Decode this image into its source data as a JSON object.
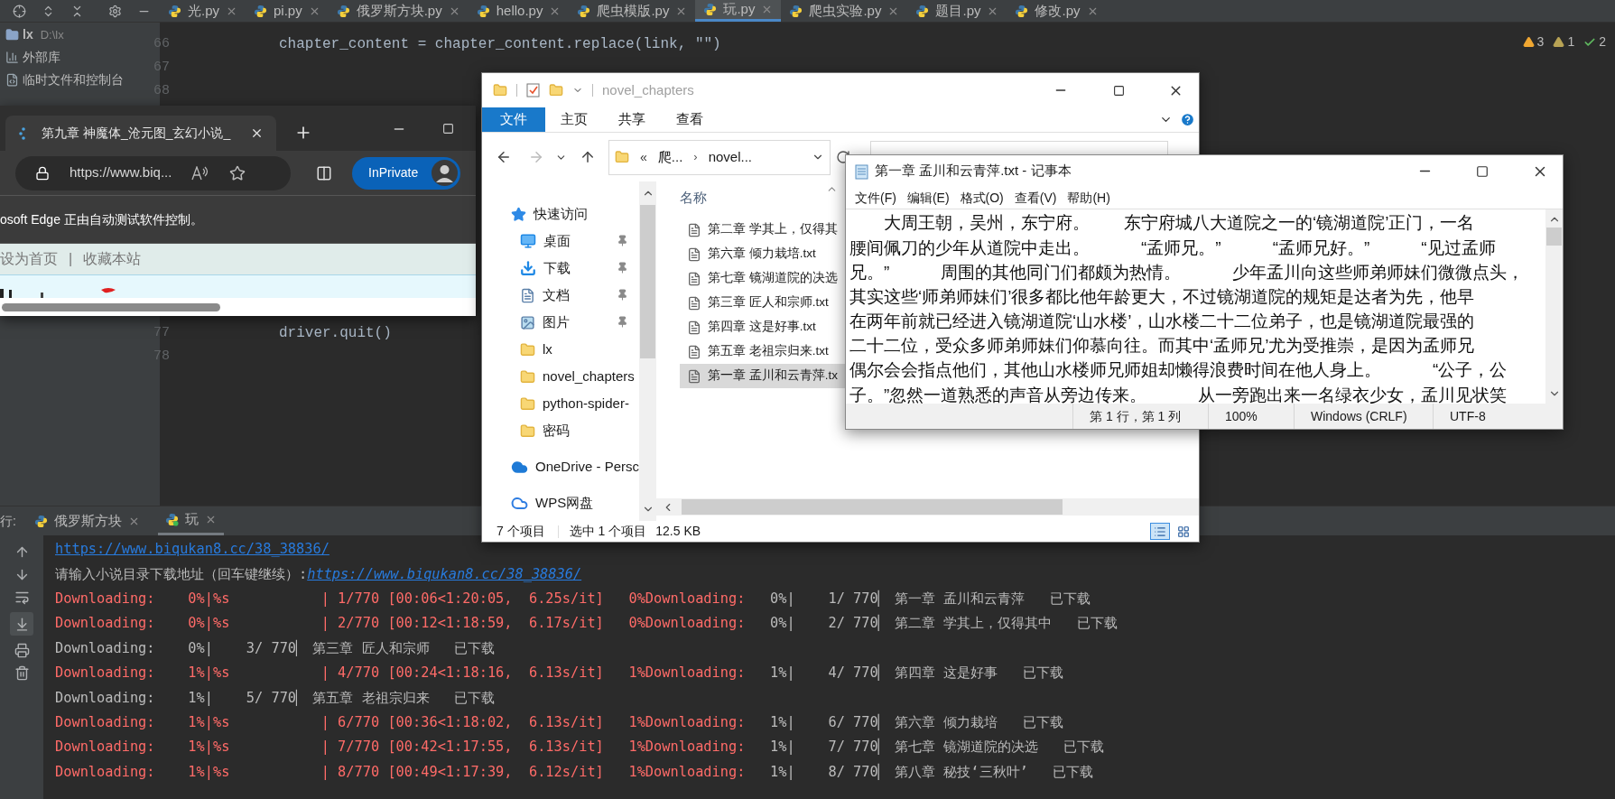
{
  "ide": {
    "tabs": [
      {
        "label": "光.py",
        "selected": false
      },
      {
        "label": "pi.py",
        "selected": false
      },
      {
        "label": "俄罗斯方块.py",
        "selected": false
      },
      {
        "label": "hello.py",
        "selected": false
      },
      {
        "label": "爬虫模版.py",
        "selected": false
      },
      {
        "label": "玩.py",
        "selected": true
      },
      {
        "label": "爬虫实验.py",
        "selected": false
      },
      {
        "label": "题目.py",
        "selected": false
      },
      {
        "label": "修改.py",
        "selected": false
      }
    ],
    "project_tree": [
      {
        "label": "lx",
        "detail": "D:\\lx",
        "kind": "folder"
      },
      {
        "label": "外部库",
        "kind": "library"
      },
      {
        "label": "临时文件和控制台",
        "kind": "scratch"
      }
    ],
    "editor": {
      "top_lines": [
        {
          "number": "66",
          "code": "chapter_content = chapter_content.replace(link, \"\")"
        },
        {
          "number": "67"
        },
        {
          "number": "68"
        }
      ],
      "bottom_lines": [
        {
          "number": "77",
          "code": "driver.quit()"
        },
        {
          "number": "78"
        }
      ]
    },
    "inspections": [
      {
        "kind": "warning",
        "count": "3"
      },
      {
        "kind": "weak-warning",
        "count": "1"
      },
      {
        "kind": "passed",
        "count": "2"
      }
    ],
    "run": {
      "label": "行:",
      "tabs": [
        {
          "label": "俄罗斯方块",
          "selected": false,
          "running": false
        },
        {
          "label": "玩",
          "selected": true,
          "running": true
        }
      ],
      "lines": [
        {
          "kind": "link",
          "text": "https://www.biqukan8.cc/38_38836/"
        },
        {
          "kind": "prompt",
          "text": "请输入小说目录下载地址（回车键继续）:",
          "link": "https://www.biqukan8.cc/38_38836/"
        },
        {
          "kind": "progress",
          "stderr": "Downloading:    0%|%s           | 1/770 [00:06<1:20:05,  6.25s/it]   0%Downloading:",
          "stdout": "   0%|    1/ 770▏ 第一章 孟川和云青萍   已下载"
        },
        {
          "kind": "progress",
          "stderr": "Downloading:    0%|%s           | 2/770 [00:12<1:18:59,  6.17s/it]   0%Downloading:",
          "stdout": "   0%|    2/ 770▏ 第二章 学其上，仅得其中   已下载"
        },
        {
          "kind": "status",
          "stdout": "Downloading:    0%|    3/ 770▏ 第三章 匠人和宗师   已下载"
        },
        {
          "kind": "progress",
          "stderr": "Downloading:    1%|%s           | 4/770 [00:24<1:18:16,  6.13s/it]   1%Downloading:",
          "stdout": "   1%|    4/ 770▏ 第四章 这是好事   已下载"
        },
        {
          "kind": "status",
          "stdout": "Downloading:    1%|    5/ 770▏ 第五章 老祖宗归来   已下载"
        },
        {
          "kind": "progress",
          "stderr": "Downloading:    1%|%s           | 6/770 [00:36<1:18:02,  6.13s/it]   1%Downloading:",
          "stdout": "   1%|    6/ 770▏ 第六章 倾力栽培   已下载"
        },
        {
          "kind": "progress",
          "stderr": "Downloading:    1%|%s           | 7/770 [00:42<1:17:55,  6.13s/it]   1%Downloading:",
          "stdout": "   1%|    7/ 770▏ 第七章 镜湖道院的决选   已下载"
        },
        {
          "kind": "progress",
          "stderr": "Downloading:    1%|%s           | 8/770 [00:49<1:17:39,  6.12s/it]   1%Downloading:",
          "stdout": "   1%|    8/ 770▏ 第八章 秘技‘三秋叶’   已下载"
        }
      ]
    }
  },
  "browser": {
    "tab_title": "第九章 神魔体_沧元图_玄幻小说_",
    "url": "https://www.biq...",
    "profile": "InPrivate",
    "infobar": "osoft Edge 正由自动测试软件控制。",
    "page_links": [
      "设为首页",
      "收藏本站"
    ],
    "separator": "|"
  },
  "explorer": {
    "title": "novel_chapters",
    "ribbon_tabs": [
      {
        "label": "文件",
        "selected": true
      },
      {
        "label": "主页",
        "selected": false
      },
      {
        "label": "共享",
        "selected": false
      },
      {
        "label": "查看",
        "selected": false
      }
    ],
    "path_prefix": "«",
    "path": [
      "爬...",
      "novel..."
    ],
    "path_separator": "›",
    "nav": [
      {
        "label": "快速访问",
        "kind": "quick-access",
        "children": [
          {
            "label": "桌面",
            "kind": "desktop",
            "pinned": true
          },
          {
            "label": "下载",
            "kind": "downloads",
            "pinned": true
          },
          {
            "label": "文档",
            "kind": "documents",
            "pinned": true
          },
          {
            "label": "图片",
            "kind": "pictures",
            "pinned": true
          },
          {
            "label": "lx",
            "kind": "folder",
            "pinned": false
          },
          {
            "label": "novel_chapters",
            "kind": "folder",
            "pinned": false
          },
          {
            "label": "python-spider-",
            "kind": "folder",
            "pinned": false
          },
          {
            "label": "密码",
            "kind": "folder",
            "pinned": false
          }
        ]
      },
      {
        "label": "OneDrive - Persc",
        "kind": "onedrive"
      },
      {
        "label": "WPS网盘",
        "kind": "cloud-drive"
      }
    ],
    "column": "名称",
    "files": [
      {
        "name": "第二章 学其上，仅得其",
        "selected": false
      },
      {
        "name": "第六章 倾力栽培.txt",
        "selected": false
      },
      {
        "name": "第七章 镜湖道院的决选",
        "selected": false
      },
      {
        "name": "第三章 匠人和宗师.txt",
        "selected": false
      },
      {
        "name": "第四章 这是好事.txt",
        "selected": false
      },
      {
        "name": "第五章 老祖宗归来.txt",
        "selected": false
      },
      {
        "name": "第一章 孟川和云青萍.tx",
        "selected": true
      }
    ],
    "status": {
      "count": "7 个项目",
      "selection": "选中 1 个项目",
      "size": "12.5 KB"
    },
    "view_modes": [
      {
        "kind": "details",
        "selected": true
      },
      {
        "kind": "thumbnails",
        "selected": false
      }
    ]
  },
  "notepad": {
    "title": "第一章 孟川和云青萍.txt - 记事本",
    "menu": [
      "文件(F)",
      "编辑(E)",
      "格式(O)",
      "查看(V)",
      "帮助(H)"
    ],
    "lines": [
      "　　大周王朝，吴州，东宁府。　　东宁府城八大道院之一的‘镜湖道院’正门，一名",
      "腰间佩刀的少年从道院中走出。　　　“孟师兄。”　　　“孟师兄好。”　　　“见过孟师",
      "兄。”　　　周围的其他同门们都颇为热情。　　　少年孟川向这些师弟师妹们微微点头，",
      "其实这些‘师弟师妹们’很多都比他年龄更大，不过镜湖道院的规矩是达者为先，他早",
      "在两年前就已经进入镜湖道院‘山水楼’，山水楼二十二位弟子，也是镜湖道院最强的",
      "二十二位，受众多师弟师妹们仰慕向往。而其中‘孟师兄’尤为受推崇，是因为孟师兄",
      "偶尔会会指点他们，其他山水楼师兄师姐却懒得浪费时间在他人身上。　　　“公子，公",
      "子。”忽然一道熟悉的声音从旁边传来。　　　从一旁跑出来一名绿衣少女，孟川见状笑"
    ],
    "status": [
      "第 1 行，第 1 列",
      "100%",
      "Windows (CRLF)",
      "UTF-8"
    ]
  }
}
